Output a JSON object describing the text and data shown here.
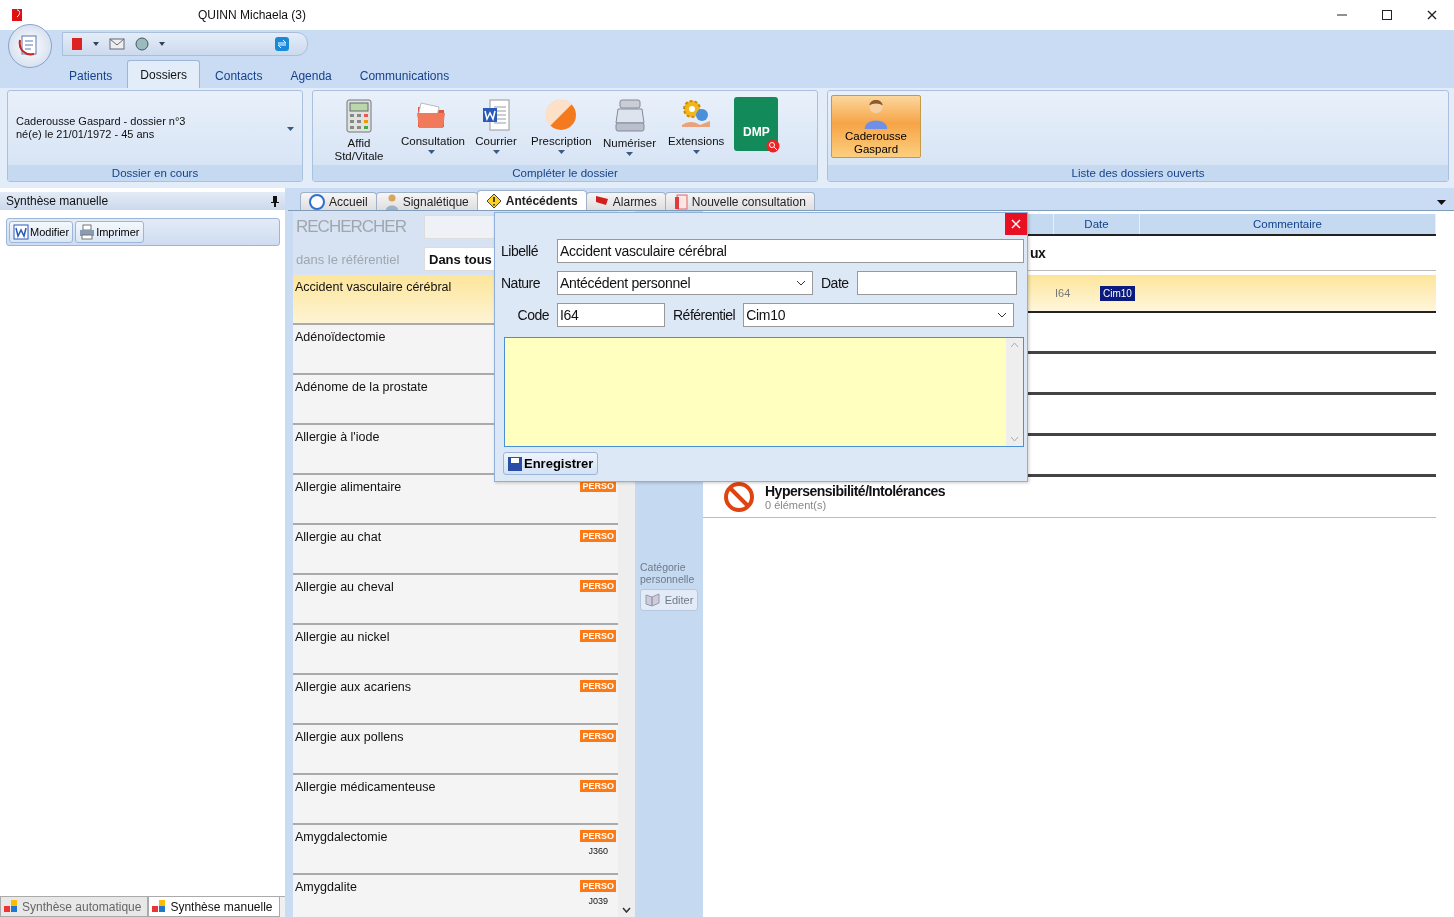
{
  "window": {
    "title": "QUINN Michaela (3)"
  },
  "ribbon": {
    "tabs": [
      {
        "label": "Patients",
        "selected": false
      },
      {
        "label": "Dossiers",
        "selected": true
      },
      {
        "label": "Contacts",
        "selected": false
      },
      {
        "label": "Agenda",
        "selected": false
      },
      {
        "label": "Communications",
        "selected": false
      }
    ],
    "groups": [
      {
        "kind": "patient",
        "label": "Dossier en cours",
        "lines": [
          "Caderousse Gaspard - dossier n°3",
          "né(e) le 21/01/1972 - 45 ans"
        ]
      },
      {
        "kind": "tools",
        "label": "Compléter le dossier",
        "buttons": [
          {
            "label": "Affid Std/Vitale",
            "dropdown": false
          },
          {
            "label": "Consultation",
            "dropdown": true
          },
          {
            "label": "Courrier",
            "dropdown": true
          },
          {
            "label": "Prescription",
            "dropdown": true
          },
          {
            "label": "Numériser",
            "dropdown": true
          },
          {
            "label": "Extensions",
            "dropdown": true
          },
          {
            "label": "DMP",
            "dropdown": false
          }
        ]
      },
      {
        "kind": "open_files",
        "label": "Liste des dossiers ouverts",
        "files": [
          {
            "label": "Caderousse Gaspard",
            "selected": true
          }
        ]
      }
    ]
  },
  "side_panel": {
    "title": "Synthèse manuelle",
    "buttons": [
      {
        "label": "Modifier"
      },
      {
        "label": "Imprimer"
      }
    ],
    "bottom_tabs": [
      {
        "label": "Synthèse automatique",
        "selected": false
      },
      {
        "label": "Synthèse manuelle",
        "selected": true
      }
    ]
  },
  "doc_tabs": [
    {
      "label": "Accueil",
      "selected": false
    },
    {
      "label": "Signalétique",
      "selected": false
    },
    {
      "label": "Antécédents",
      "selected": true
    },
    {
      "label": "Alarmes",
      "selected": false
    },
    {
      "label": "Nouvelle consultation",
      "selected": false
    }
  ],
  "search": {
    "label": "RECHERCHER",
    "scope_label": "dans le référentiel",
    "scope_value": "Dans tous"
  },
  "referential_list": [
    {
      "label": "Accident vasculaire cérébral",
      "selected": true
    },
    {
      "label": "Adénoïdectomie",
      "selected": false
    },
    {
      "label": "Adénome de la prostate",
      "selected": false
    },
    {
      "label": "Allergie à l'iode",
      "selected": false
    },
    {
      "label": "Allergie alimentaire",
      "selected": false,
      "badge": "PERSO"
    },
    {
      "label": "Allergie au chat",
      "selected": false,
      "badge": "PERSO"
    },
    {
      "label": "Allergie au cheval",
      "selected": false,
      "badge": "PERSO"
    },
    {
      "label": "Allergie au nickel",
      "selected": false,
      "badge": "PERSO"
    },
    {
      "label": "Allergie aux acariens",
      "selected": false,
      "badge": "PERSO"
    },
    {
      "label": "Allergie aux pollens",
      "selected": false,
      "badge": "PERSO"
    },
    {
      "label": "Allergie médicamenteuse",
      "selected": false,
      "badge": "PERSO"
    },
    {
      "label": "Amygdalectomie",
      "selected": false,
      "badge": "PERSO",
      "code": "J360"
    },
    {
      "label": "Amygdalite",
      "selected": false,
      "badge": "PERSO",
      "code": "J039"
    }
  ],
  "category": {
    "label": "Catégorie personnelle",
    "button": "Editer",
    "disabled": true
  },
  "history": {
    "columns": [
      "Date",
      "Commentaire"
    ],
    "groups": [
      {
        "kind": "list",
        "title": "ux",
        "rows": [
          {
            "code": "I64",
            "referential": "Cim10",
            "selected": true
          }
        ]
      },
      {
        "kind": "empty",
        "title": "Hypersensibilité/Intolérances",
        "count": "0 élément(s)"
      }
    ]
  },
  "dialog": {
    "libelle_label": "Libellé",
    "libelle_value": "Accident vasculaire cérébral",
    "nature_label": "Nature",
    "nature_value": "Antécédent personnel",
    "date_label": "Date",
    "code_label": "Code",
    "code_value": "I64",
    "referentiel_label": "Référentiel",
    "referentiel_value": "Cim10",
    "save_button": "Enregistrer"
  }
}
